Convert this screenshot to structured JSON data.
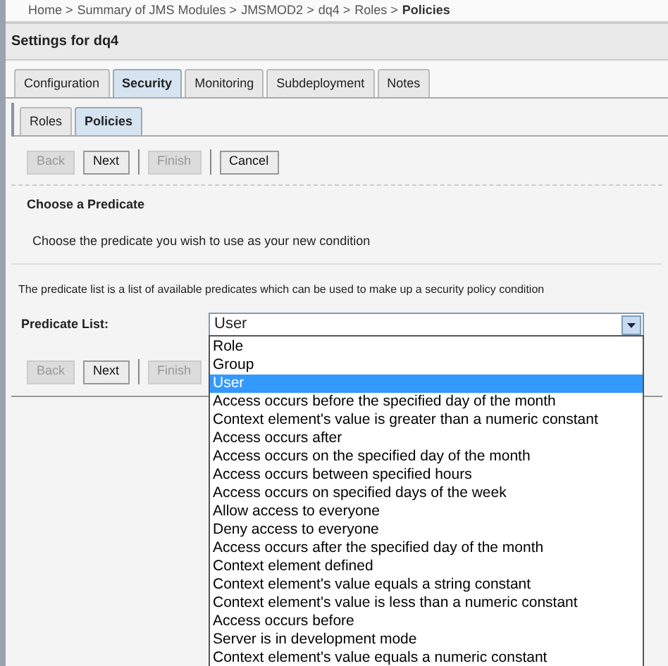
{
  "breadcrumb": [
    {
      "label": "Home >",
      "current": false
    },
    {
      "label": "Summary of JMS Modules >",
      "current": false
    },
    {
      "label": "JMSMOD2 >",
      "current": false
    },
    {
      "label": "dq4 >",
      "current": false
    },
    {
      "label": "Roles >",
      "current": false
    },
    {
      "label": "Policies",
      "current": true
    }
  ],
  "header": "Settings for dq4",
  "tabs": [
    {
      "label": "Configuration",
      "selected": false
    },
    {
      "label": "Security",
      "selected": true
    },
    {
      "label": "Monitoring",
      "selected": false
    },
    {
      "label": "Subdeployment",
      "selected": false
    },
    {
      "label": "Notes",
      "selected": false
    }
  ],
  "subtabs": [
    {
      "label": "Roles",
      "selected": false
    },
    {
      "label": "Policies",
      "selected": true
    }
  ],
  "buttons_top": [
    {
      "label": "Back",
      "disabled": true
    },
    {
      "label": "Next",
      "disabled": false
    },
    {
      "label": "Finish",
      "disabled": true
    },
    {
      "label": "Cancel",
      "disabled": false
    }
  ],
  "section_title": "Choose a Predicate",
  "section_description": "Choose the predicate you wish to use as your new condition",
  "info": "The predicate list is a list of available predicates which can be used to make up a security policy condition",
  "predicate_field": {
    "label": "Predicate List:",
    "value": "User",
    "expanded": true,
    "options": [
      {
        "label": "Role",
        "selected": false
      },
      {
        "label": "Group",
        "selected": false
      },
      {
        "label": "User",
        "selected": true
      },
      {
        "label": "Access occurs before the specified day of the month",
        "selected": false
      },
      {
        "label": "Context element's value is greater than a numeric constant",
        "selected": false
      },
      {
        "label": "Access occurs after",
        "selected": false
      },
      {
        "label": "Access occurs on the specified day of the month",
        "selected": false
      },
      {
        "label": "Access occurs between specified hours",
        "selected": false
      },
      {
        "label": "Access occurs on specified days of the week",
        "selected": false
      },
      {
        "label": "Allow access to everyone",
        "selected": false
      },
      {
        "label": "Deny access to everyone",
        "selected": false
      },
      {
        "label": "Access occurs after the specified day of the month",
        "selected": false
      },
      {
        "label": "Context element defined",
        "selected": false
      },
      {
        "label": "Context element's value equals a string constant",
        "selected": false
      },
      {
        "label": "Context element's value is less than a numeric constant",
        "selected": false
      },
      {
        "label": "Access occurs before",
        "selected": false
      },
      {
        "label": "Server is in development mode",
        "selected": false
      },
      {
        "label": "Context element's value equals a numeric constant",
        "selected": false
      }
    ]
  },
  "buttons_bottom": [
    {
      "label": "Back",
      "disabled": true
    },
    {
      "label": "Next",
      "disabled": false
    },
    {
      "label": "Finish",
      "disabled": true
    }
  ]
}
